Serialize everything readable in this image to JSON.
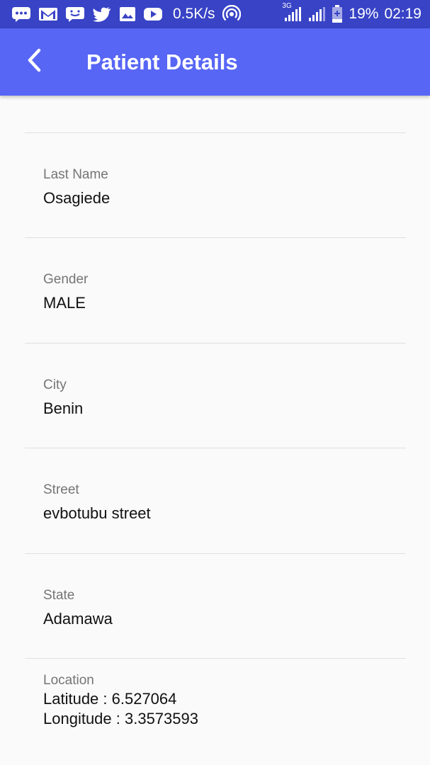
{
  "status_bar": {
    "net_speed": "0.5K/s",
    "network_type": "3G",
    "battery": "19%",
    "time": "02:19",
    "icons": [
      "message-icon",
      "gmail-icon",
      "chat-icon",
      "twitter-icon",
      "image-icon",
      "youtube-icon",
      "hotspot-icon",
      "signal-icon",
      "signal-icon",
      "battery-icon"
    ]
  },
  "app_bar": {
    "title": "Patient Details",
    "back_icon": "chevron-left-icon",
    "color": "#5766f5"
  },
  "fields": [
    {
      "label": "Last Name",
      "value": "Osagiede"
    },
    {
      "label": "Gender",
      "value": "MALE"
    },
    {
      "label": "City",
      "value": "Benin"
    },
    {
      "label": "Street",
      "value": "evbotubu street"
    },
    {
      "label": "State",
      "value": "Adamawa"
    }
  ],
  "location": {
    "label": "Location",
    "latitude": "Latitude : 6.527064",
    "longitude": "Longitude : 3.3573593"
  }
}
